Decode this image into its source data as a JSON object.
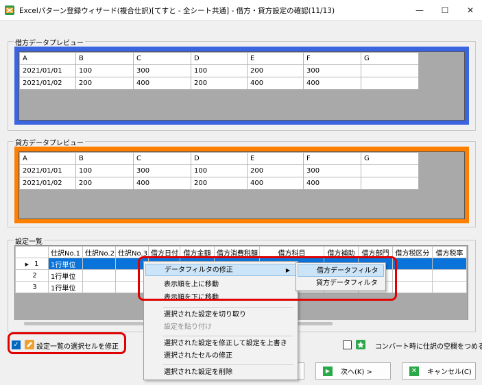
{
  "window": {
    "title": "Excelパターン登録ウィザード(複合仕訳)[てすと - 全シート共通] - 借方・貸方設定の確認(11/13)",
    "minimize": "—",
    "maximize": "☐",
    "close": "✕"
  },
  "debit_preview": {
    "title": "借方データプレビュー",
    "frame_color": "#3b64e0",
    "headers": [
      "A",
      "B",
      "C",
      "D",
      "E",
      "F",
      "G"
    ],
    "rows": [
      [
        "2021/01/01",
        "100",
        "300",
        "100",
        "200",
        "300",
        ""
      ],
      [
        "2021/01/02",
        "200",
        "400",
        "200",
        "400",
        "400",
        ""
      ]
    ]
  },
  "credit_preview": {
    "title": "貸方データプレビュー",
    "frame_color": "#ff8000",
    "headers": [
      "A",
      "B",
      "C",
      "D",
      "E",
      "F",
      "G"
    ],
    "rows": [
      [
        "2021/01/01",
        "100",
        "300",
        "100",
        "200",
        "300",
        ""
      ],
      [
        "2021/01/02",
        "200",
        "400",
        "200",
        "400",
        "400",
        ""
      ]
    ]
  },
  "settings": {
    "title": "設定一覧",
    "headers": [
      "",
      "仕訳No.1",
      "仕訳No.2",
      "仕訳No.3",
      "借方日付",
      "借方金額",
      "借方消費税額",
      "借方科目",
      "借方補助",
      "借方部門",
      "借方税区分",
      "借方税率"
    ],
    "rows": [
      {
        "marker": "▶",
        "num": "1",
        "cells": [
          "1行単位",
          "",
          "",
          "",
          "",
          "",
          "",
          "",
          "",
          "",
          ""
        ]
      },
      {
        "marker": "",
        "num": "2",
        "cells": [
          "1行単位",
          "",
          "",
          "",
          "",
          "",
          "",
          "",
          "",
          "",
          ""
        ]
      },
      {
        "marker": "",
        "num": "3",
        "cells": [
          "1行単位",
          "",
          "",
          "",
          "",
          "",
          "",
          "",
          "",
          "",
          ""
        ]
      }
    ],
    "selected_row": 0
  },
  "context_menu": {
    "items": [
      {
        "label": "データフィルタの修正",
        "state": "highlighted",
        "submenu": true
      },
      {
        "label": "表示順を上に移動",
        "state": "normal"
      },
      {
        "label": "表示順を下に移動",
        "state": "normal"
      },
      {
        "label": "選択された設定を切り取り",
        "state": "normal"
      },
      {
        "label": "設定を貼り付け",
        "state": "disabled"
      },
      {
        "label": "選択された設定を修正して設定を上書き",
        "state": "normal"
      },
      {
        "label": "選択されたセルの修正",
        "state": "normal"
      },
      {
        "label": "選択された設定を削除",
        "state": "normal"
      }
    ],
    "submenu_items": [
      {
        "label": "借方データフィルタ",
        "state": "highlighted"
      },
      {
        "label": "貸方データフィルタ",
        "state": "normal"
      }
    ],
    "submenu_arrow": "▶"
  },
  "options": {
    "edit_selected_cell": {
      "label": "設定一覧の選択セルを修正",
      "checked": true,
      "check_glyph": "✓"
    },
    "fill_blank": {
      "label": "コンバート時に仕訳の空欄をつめる",
      "checked": false
    }
  },
  "buttons": {
    "next": {
      "label": "次へ(K) >"
    },
    "cancel": {
      "label": "キャンセル(C)"
    }
  },
  "colors": {
    "highlight_red": "#e00000",
    "selection_blue": "#0a73d9"
  }
}
